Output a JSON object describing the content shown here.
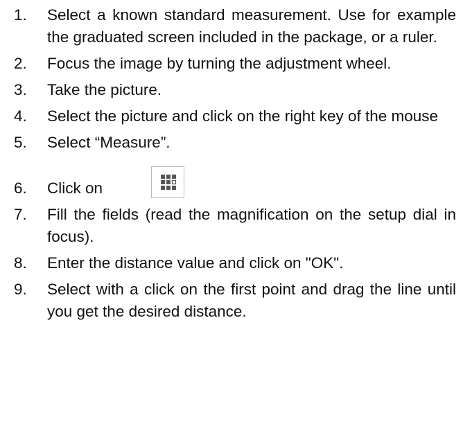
{
  "steps": [
    {
      "num": "1.",
      "text": "Select a known standard measurement. Use for example the graduated screen included in the package, or a ruler."
    },
    {
      "num": "2.",
      "text": "Focus the image by turning the adjustment wheel."
    },
    {
      "num": "3.",
      "text": "Take the picture."
    },
    {
      "num": "4.",
      "text": "Select the picture and click on the right key of the mouse"
    },
    {
      "num": "5.",
      "text": "Select “Measure”."
    },
    {
      "num": "6.",
      "text": "Click on",
      "icon": "measure-grid-icon"
    },
    {
      "num": "7.",
      "text": "Fill the fields (read the magnification on the setup dial in focus)."
    },
    {
      "num": "8.",
      "text": "Enter the distance value and click on \"OK\"."
    },
    {
      "num": "9.",
      "text": "Select with a click on the first point and drag the line until you get the desired distance."
    }
  ]
}
